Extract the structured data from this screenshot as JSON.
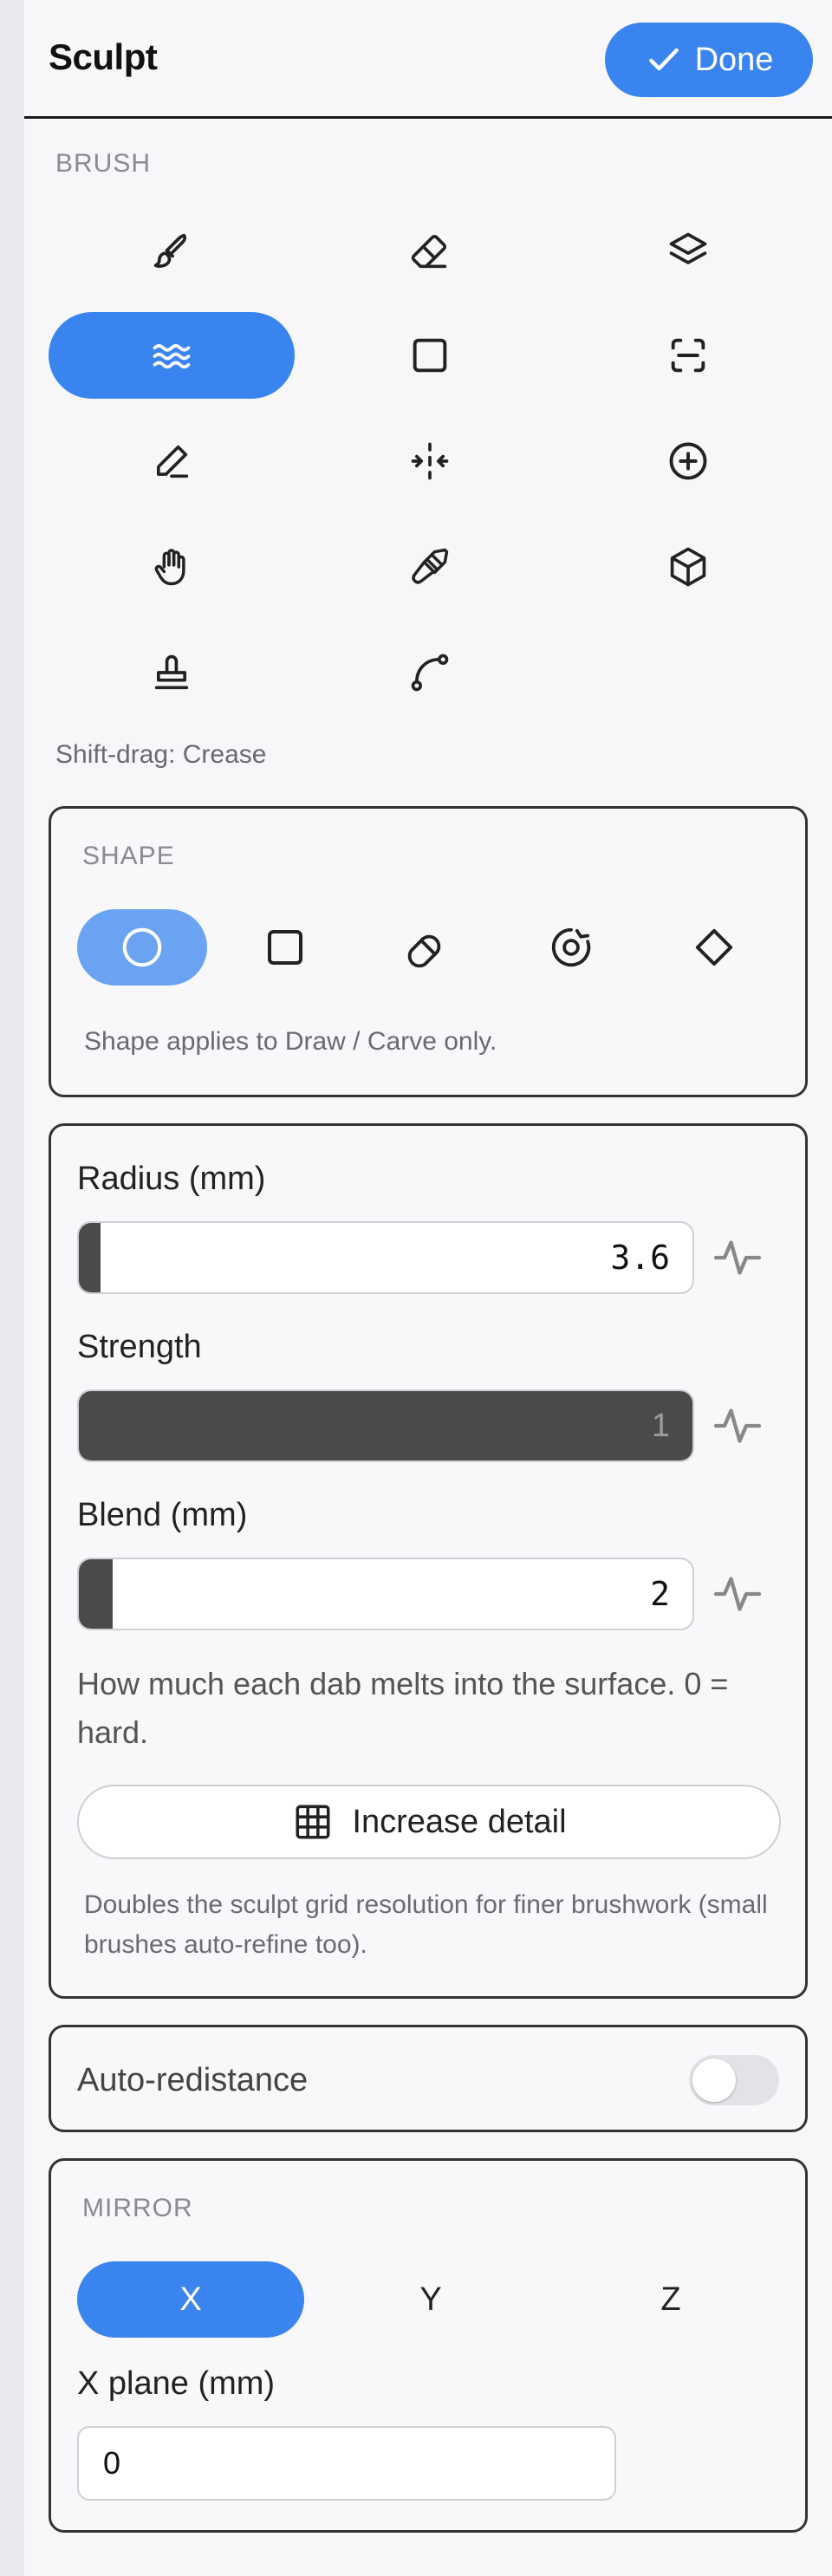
{
  "header": {
    "title": "Sculpt",
    "done_label": "Done"
  },
  "brush": {
    "label": "BRUSH",
    "tools": [
      {
        "icon": "brush-icon",
        "active": false
      },
      {
        "icon": "eraser-icon",
        "active": false
      },
      {
        "icon": "layers-icon",
        "active": false
      },
      {
        "icon": "waves-icon",
        "active": true
      },
      {
        "icon": "square-icon",
        "active": false
      },
      {
        "icon": "scan-icon",
        "active": false
      },
      {
        "icon": "pencil-icon",
        "active": false
      },
      {
        "icon": "pinch-icon",
        "active": false
      },
      {
        "icon": "plus-circle-icon",
        "active": false
      },
      {
        "icon": "hand-icon",
        "active": false
      },
      {
        "icon": "paint-brush-icon",
        "active": false
      },
      {
        "icon": "cube-icon",
        "active": false
      },
      {
        "icon": "stamp-icon",
        "active": false
      },
      {
        "icon": "curve-icon",
        "active": false
      }
    ],
    "hint": "Shift-drag: Crease"
  },
  "shape": {
    "label": "SHAPE",
    "shapes": [
      {
        "icon": "circle-icon",
        "active": true
      },
      {
        "icon": "square-icon",
        "active": false
      },
      {
        "icon": "pill-icon",
        "active": false
      },
      {
        "icon": "target-icon",
        "active": false
      },
      {
        "icon": "diamond-icon",
        "active": false
      }
    ],
    "hint": "Shape applies to Draw / Carve only."
  },
  "params": {
    "radius": {
      "label": "Radius (mm)",
      "value": "3.6",
      "fill_fraction": 0.035
    },
    "strength": {
      "label": "Strength",
      "value": "1",
      "fill_fraction": 1.0
    },
    "blend": {
      "label": "Blend (mm)",
      "value": "2",
      "fill_fraction": 0.055
    },
    "blend_desc": "How much each dab melts into the surface. 0 = hard.",
    "detail_label": "Increase detail",
    "detail_desc": "Doubles the sculpt grid resolution for finer brushwork (small brushes auto-refine too)."
  },
  "redistance": {
    "label": "Auto-redistance",
    "enabled": false
  },
  "mirror": {
    "label": "MIRROR",
    "axes": [
      {
        "label": "X",
        "active": true
      },
      {
        "label": "Y",
        "active": false
      },
      {
        "label": "Z",
        "active": false
      }
    ],
    "plane_label": "X plane (mm)",
    "plane_value": "0"
  },
  "colors": {
    "accent": "#3a84ef",
    "accent_light": "#6aa3f2",
    "slider_fill": "#4a4a4a"
  }
}
